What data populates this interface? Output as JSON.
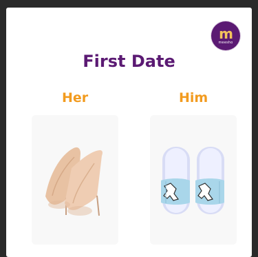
{
  "brand": {
    "logo_mark": "m",
    "logo_word": "meesho"
  },
  "title": "First Date",
  "her": {
    "label": "Her",
    "image": "nude-stiletto-heels"
  },
  "him": {
    "label": "Him",
    "image": "white-slides-printed-strap"
  },
  "colors": {
    "title": "#5b1a73",
    "label": "#f29b1f",
    "brand": "#5b1a73"
  }
}
